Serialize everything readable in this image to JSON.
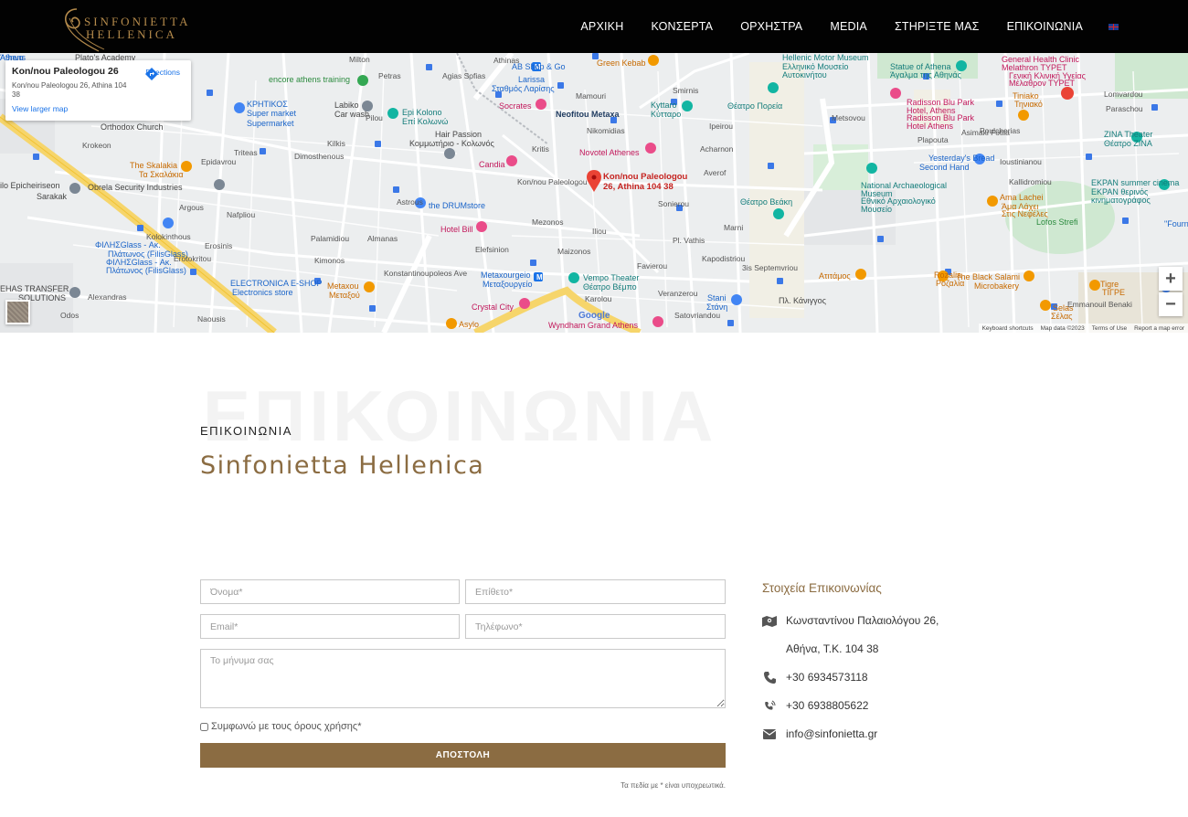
{
  "brand": {
    "line1": "SINFONIETTA",
    "line2": "HELLENICA",
    "accent_color": "#8b6c42"
  },
  "nav": {
    "items": [
      "ΑΡΧΙΚΗ",
      "ΚΟΝΣΕΡΤΑ",
      "ΟΡΧΗΣΤΡΑ",
      "MEDIA",
      "ΣΤΗΡΙΞΤΕ ΜΑΣ",
      "ΕΠΙΚΟΙΝΩΝΙΑ"
    ],
    "language_icon": "uk-flag-icon"
  },
  "map": {
    "card_title": "Kon/nou Paleologou 26",
    "card_address": "Kon/nou Paleologou 26, Athina 104 38",
    "directions": "Directions",
    "larger_map": "View larger map",
    "pin_label_1": "Kon/nou Paleologou",
    "pin_label_2": "26, Athina 104 38",
    "google": "Google",
    "footer": [
      "Keyboard shortcuts",
      "Map data ©2023",
      "Terms of Use",
      "Report a map error"
    ],
    "zoom_in": "+",
    "zoom_out": "−",
    "labels": [
      {
        "t": "Plato's Academy",
        "c": ""
      },
      {
        "t": "encore athens training",
        "c": "green"
      },
      {
        "t": "ΚΡΗΤΙΚΟΣ",
        "c": "blue"
      },
      {
        "t": "Super market",
        "c": "blue"
      },
      {
        "t": "Supermarket",
        "c": "blue"
      },
      {
        "t": "Labiko",
        "c": ""
      },
      {
        "t": "Car wash",
        "c": ""
      },
      {
        "t": "Epi Kolono",
        "c": "teal"
      },
      {
        "t": "Επί Κολωνώ",
        "c": "teal"
      },
      {
        "t": "Orthodox Church",
        "c": ""
      },
      {
        "t": "The Skalakia",
        "c": "orange"
      },
      {
        "t": "Τα Σκαλάκια",
        "c": "orange"
      },
      {
        "t": "ilo Epicheiriseon",
        "c": ""
      },
      {
        "t": "Sarakak",
        "c": ""
      },
      {
        "t": "Obrela Security Industries",
        "c": ""
      },
      {
        "t": "ΦΙΛΗΣGlass - Ακ.",
        "c": "blue"
      },
      {
        "t": "Πλάτωνος (FilisGlass)",
        "c": "blue"
      },
      {
        "t": "ΦΙΛΗΣGlass - Ακ.",
        "c": "blue"
      },
      {
        "t": "Πλάτωνος (FilisGlass)",
        "c": "blue"
      },
      {
        "t": "EHAS TRANSFER",
        "c": ""
      },
      {
        "t": "SOLUTIONS",
        "c": ""
      },
      {
        "t": "ELECTRONICA E-SHOP",
        "c": "blue"
      },
      {
        "t": "Electronics store",
        "c": "blue"
      },
      {
        "t": "Metaxou",
        "c": "orange"
      },
      {
        "t": "Μεταξού",
        "c": "orange"
      },
      {
        "t": "Hair Passion",
        "c": ""
      },
      {
        "t": "Κομμωτήριο - Κολωνός",
        "c": ""
      },
      {
        "t": "Larissa",
        "c": "blue"
      },
      {
        "t": "Σταθμός Λαρίσης",
        "c": "blue"
      },
      {
        "t": "Socrates",
        "c": "pink"
      },
      {
        "t": "Candia",
        "c": "pink"
      },
      {
        "t": "the DRUMstore",
        "c": "blue"
      },
      {
        "t": "Hotel Bill",
        "c": "pink"
      },
      {
        "t": "Green Kebab",
        "c": "orange"
      },
      {
        "t": "Neofitou Metaxa",
        "c": "dark"
      },
      {
        "t": "Novotel Athenes",
        "c": "pink"
      },
      {
        "t": "Kyttaro",
        "c": "teal"
      },
      {
        "t": "Κύτταρο",
        "c": "teal"
      },
      {
        "t": "Θέατρο Πορεία",
        "c": "teal"
      },
      {
        "t": "Metaxourgeio",
        "c": "blue"
      },
      {
        "t": "Μεταξουργείο",
        "c": "blue"
      },
      {
        "t": "Vempo Theater",
        "c": "teal"
      },
      {
        "t": "Θέατρο Βέμπο",
        "c": "teal"
      },
      {
        "t": "Crystal City",
        "c": "pink"
      },
      {
        "t": "Wyndham Grand Athens",
        "c": "pink"
      },
      {
        "t": "Asylo",
        "c": "orange"
      },
      {
        "t": "Stani",
        "c": "blue"
      },
      {
        "t": "Στάνη",
        "c": "blue"
      },
      {
        "t": "Hellenic Motor Museum",
        "c": "teal"
      },
      {
        "t": "Ελληνικό Μουσείο",
        "c": "teal"
      },
      {
        "t": "Αυτοκινήτου",
        "c": "teal"
      },
      {
        "t": "Statue of Athena",
        "c": "teal"
      },
      {
        "t": "Άγαλμα της Αθηνάς",
        "c": "teal"
      },
      {
        "t": "General Health Clinic",
        "c": "pink"
      },
      {
        "t": "Melathron ΤΥΡΕΤ",
        "c": "pink"
      },
      {
        "t": "Γενική Κλινική Υγείας",
        "c": "pink"
      },
      {
        "t": "Μέλαθρον ΤΥΡΕΤ",
        "c": "pink"
      },
      {
        "t": "Tiniako",
        "c": "orange"
      },
      {
        "t": "Τηνιακό",
        "c": "orange"
      },
      {
        "t": "Radisson Blu Park",
        "c": "pink"
      },
      {
        "t": "Hotel, Athens",
        "c": "pink"
      },
      {
        "t": "Radisson Blu Park",
        "c": "pink"
      },
      {
        "t": "Hotel Athens",
        "c": "pink"
      },
      {
        "t": "Yesterday's Bread",
        "c": "blue"
      },
      {
        "t": "Second Hand",
        "c": "blue"
      },
      {
        "t": "National Archaeological",
        "c": "teal"
      },
      {
        "t": "Museum",
        "c": "teal"
      },
      {
        "t": "Εθνικό Αρχαιολογικό",
        "c": "teal"
      },
      {
        "t": "Μουσείο",
        "c": "teal"
      },
      {
        "t": "Θέατρο Βεάκη",
        "c": "teal"
      },
      {
        "t": "ZINA Theater",
        "c": "teal"
      },
      {
        "t": "Θέατρο ZINA",
        "c": "teal"
      },
      {
        "t": "EKPAN summer cinema",
        "c": "teal"
      },
      {
        "t": "EKPAN θερινός",
        "c": "teal"
      },
      {
        "t": "κινηματογράφος",
        "c": "teal"
      },
      {
        "t": "Ama Lachei",
        "c": "orange"
      },
      {
        "t": "Άμα Λάχει",
        "c": "orange"
      },
      {
        "t": "Στις Νεφέλες",
        "c": "orange"
      },
      {
        "t": "Lofos Strefi",
        "c": "green"
      },
      {
        "t": "\"Fourn",
        "c": "blue"
      },
      {
        "t": "Ατιτάμος",
        "c": "orange"
      },
      {
        "t": "Rozalia",
        "c": "orange"
      },
      {
        "t": "Ροζαλία",
        "c": "orange"
      },
      {
        "t": "The Black Salami",
        "c": "orange"
      },
      {
        "t": "Microbakery",
        "c": "orange"
      },
      {
        "t": "Tigre",
        "c": "orange"
      },
      {
        "t": "ΤΙΓΡΕ",
        "c": "orange"
      },
      {
        "t": "Selas",
        "c": "orange"
      },
      {
        "t": "Σέλας",
        "c": "orange"
      },
      {
        "t": "Πλ. Κάνιγγος",
        "c": ""
      },
      {
        "t": "Ipeirou",
        "c": "street"
      },
      {
        "t": "Averof",
        "c": "street"
      },
      {
        "t": "Marni",
        "c": "street"
      },
      {
        "t": "Pl. Vathis",
        "c": "street"
      },
      {
        "t": "Kapodistriou",
        "c": "street"
      },
      {
        "t": "3is Septemvriou",
        "c": "street"
      },
      {
        "t": "Veranzerou",
        "c": "street"
      },
      {
        "t": "Satovriandou",
        "c": "street"
      },
      {
        "t": "Karolou",
        "c": "street"
      },
      {
        "t": "Mezonos",
        "c": "street"
      },
      {
        "t": "Elefsinion",
        "c": "street"
      },
      {
        "t": "Konstantinoupoleos Ave",
        "c": "street"
      },
      {
        "t": "Palamidiou",
        "c": "street"
      },
      {
        "t": "Kimonos",
        "c": "street"
      },
      {
        "t": "Argous",
        "c": "street"
      },
      {
        "t": "Nafpliou",
        "c": "street"
      },
      {
        "t": "Erotokritou",
        "c": "street"
      },
      {
        "t": "Kolokinthous",
        "c": "street"
      },
      {
        "t": "Mamouri",
        "c": "street"
      },
      {
        "t": "Acharnon",
        "c": "street"
      },
      {
        "t": "Alexandras",
        "c": "street"
      },
      {
        "t": "Metsovou",
        "c": "street"
      },
      {
        "t": "Plapouta",
        "c": "street"
      },
      {
        "t": "Poulcherias",
        "c": "street"
      },
      {
        "t": "Kallidromiou",
        "c": "street"
      },
      {
        "t": "Emmanouil Benaki",
        "c": "street"
      },
      {
        "t": "Paraschou",
        "c": "street"
      },
      {
        "t": "Lomvardou",
        "c": "street"
      },
      {
        "t": "Asimaki Fotila",
        "c": "street"
      },
      {
        "t": "Ioustinianou",
        "c": "street"
      },
      {
        "t": "Nikomidias",
        "c": "street"
      },
      {
        "t": "Kon/nou Paleologou",
        "c": "street"
      },
      {
        "t": "Milton",
        "c": "street"
      },
      {
        "t": "Smirnis",
        "c": "street"
      },
      {
        "t": "Kritis",
        "c": "street"
      },
      {
        "t": "Iliou",
        "c": "street"
      },
      {
        "t": "Sonierou",
        "c": "street"
      },
      {
        "t": "Favierou",
        "c": "street"
      },
      {
        "t": "Maizonos",
        "c": "street"
      },
      {
        "t": "Odos",
        "c": "street"
      },
      {
        "t": "Naousis",
        "c": "street"
      },
      {
        "t": "Petras",
        "c": "street"
      },
      {
        "t": "Pilou",
        "c": "street"
      },
      {
        "t": "Astrous",
        "c": "street"
      },
      {
        "t": "Almanas",
        "c": "street"
      },
      {
        "t": "Kilkis",
        "c": "street"
      },
      {
        "t": "Triteas",
        "c": "street"
      },
      {
        "t": "Epidavrou",
        "c": "street"
      },
      {
        "t": "Erosinis",
        "c": "street"
      },
      {
        "t": "Krokeon",
        "c": "street"
      },
      {
        "t": "Dimosthenous",
        "c": "street"
      },
      {
        "t": "Agias Sofias",
        "c": "street"
      },
      {
        "t": "Athinas",
        "c": "street"
      },
      {
        "t": "AB Shop & Go",
        "c": "blue"
      },
      {
        "t": "Athens",
        "c": "blue"
      },
      {
        "t": "Άθηνα",
        "c": "blue"
      }
    ]
  },
  "contact": {
    "bg_title": "ΕΠΙΚΟΙΝΩΝΙΑ",
    "small_title": "ΕΠΙΚΟΙΝΩΝΙΑ",
    "big_title": "Sinfonietta Hellenica",
    "form": {
      "name_placeholder": "Όνομα*",
      "surname_placeholder": "Επίθετο*",
      "email_placeholder": "Email*",
      "phone_placeholder": "Τηλέφωνο*",
      "message_placeholder": "Το μήνυμα σας",
      "terms_label": "Συμφωνώ με τους όρους χρήσης*",
      "submit_label": "ΑΠΟΣΤΟΛΗ",
      "required_note": "Τα πεδία με * είναι υποχρεωτικά."
    },
    "info": {
      "heading": "Στοιχεία Επικοινωνίας",
      "address_line1": "Κωνσταντίνου Παλαιολόγου 26,",
      "address_line2": "Αθήνα, Τ.Κ. 104 38",
      "phone1": "+30 6934573118",
      "phone2": "+30 6938805622",
      "email": "info@sinfonietta.gr",
      "icons": [
        "map-location-icon",
        "phone-icon",
        "mobile-vibrate-icon",
        "envelope-icon"
      ]
    }
  }
}
